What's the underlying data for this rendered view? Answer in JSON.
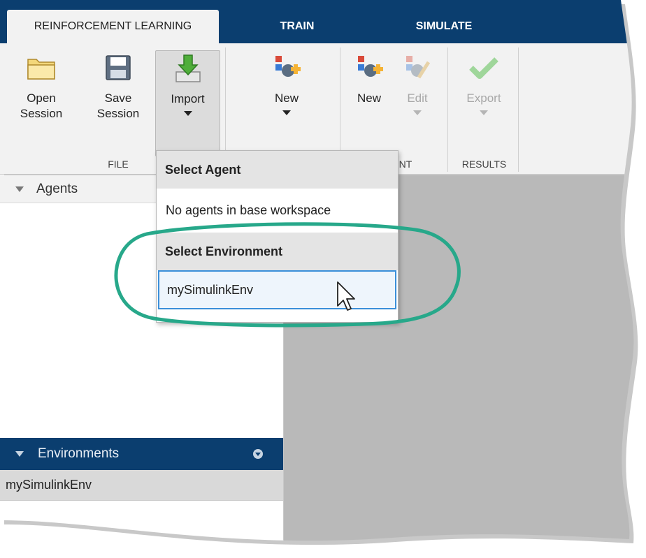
{
  "tabs": [
    {
      "label": "REINFORCEMENT LEARNING",
      "active": true
    },
    {
      "label": "TRAIN",
      "active": false
    },
    {
      "label": "SIMULATE",
      "active": false
    }
  ],
  "ribbon": {
    "open_session": {
      "line1": "Open",
      "line2": "Session",
      "icon": "folder-icon"
    },
    "save_session": {
      "line1": "Save",
      "line2": "Session",
      "icon": "floppy-disk-icon"
    },
    "import": {
      "label": "Import",
      "icon": "import-arrow-icon"
    },
    "new_env": {
      "label": "New",
      "icon": "new-environment-icon"
    },
    "new_agent": {
      "label": "New",
      "icon": "new-agent-icon"
    },
    "edit_agent": {
      "label": "Edit",
      "icon": "edit-agent-icon",
      "disabled": true
    },
    "export": {
      "label": "Export",
      "icon": "checkmark-icon",
      "disabled": true
    },
    "groups": {
      "file": "FILE",
      "agent_partial": "NT",
      "results": "RESULTS"
    }
  },
  "dropdown": {
    "agent_header": "Select Agent",
    "agent_empty": "No agents in base workspace",
    "env_header": "Select Environment",
    "env_items": [
      "mySimulinkEnv"
    ]
  },
  "panels": {
    "agents_title": "Agents",
    "environments_title": "Environments",
    "environments": [
      "mySimulinkEnv"
    ]
  },
  "colors": {
    "tab_bar": "#0b3e6f",
    "ribbon": "#f2f2f2",
    "highlight_ring": "#27a88a",
    "selection_border": "#3b8fd9",
    "workspace_gray": "#b9b9b9"
  }
}
